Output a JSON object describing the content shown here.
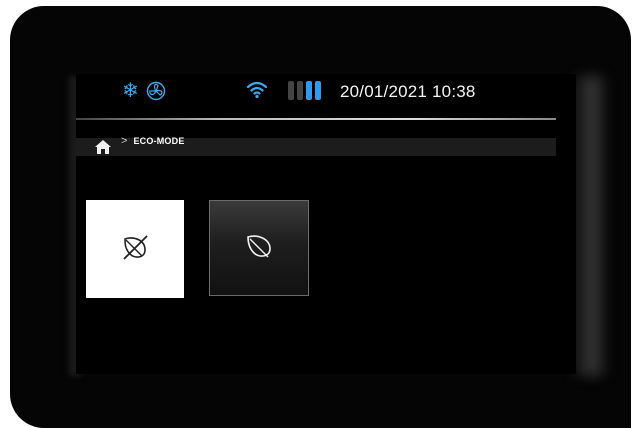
{
  "status": {
    "icons": [
      "snowflake-icon",
      "fan-icon",
      "wifi-icon",
      "battery-icon"
    ],
    "accent_color": "#2d9cf0",
    "battery_level_fraction": 0.5,
    "datetime": "20/01/2021  10:38"
  },
  "breadcrumb": {
    "home_icon": "home-icon",
    "separator": ">",
    "current": "ECO-MODE"
  },
  "tiles": [
    {
      "name": "eco-off",
      "icon": "leaf-crossed-icon",
      "selected": true
    },
    {
      "name": "eco-on",
      "icon": "leaf-icon",
      "selected": false
    }
  ]
}
